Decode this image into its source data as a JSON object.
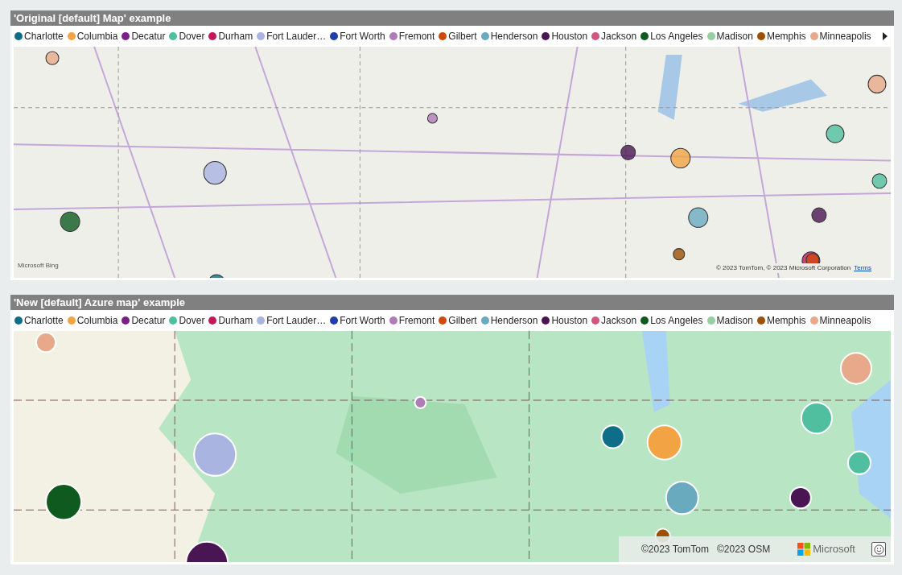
{
  "visuals": [
    {
      "kind": "bing",
      "title": "'Original [default] Map' example",
      "more_arrow": true,
      "legend": [
        {
          "label": "Charlotte",
          "color": "#0e6e89"
        },
        {
          "label": "Columbia",
          "color": "#f2a444"
        },
        {
          "label": "Decatur",
          "color": "#7a1f87"
        },
        {
          "label": "Dover",
          "color": "#4fbf9f"
        },
        {
          "label": "Durham",
          "color": "#c2185b"
        },
        {
          "label": "Fort Lauder…",
          "color": "#a9b4e0"
        },
        {
          "label": "Fort Worth",
          "color": "#1f3ea8"
        },
        {
          "label": "Fremont",
          "color": "#b07cb8"
        },
        {
          "label": "Gilbert",
          "color": "#cc4a0a"
        },
        {
          "label": "Henderson",
          "color": "#6aaabf"
        },
        {
          "label": "Houston",
          "color": "#4a1553"
        },
        {
          "label": "Jackson",
          "color": "#d0577f"
        },
        {
          "label": "Los Angeles",
          "color": "#0f5b1f"
        },
        {
          "label": "Madison",
          "color": "#96d0a0"
        },
        {
          "label": "Memphis",
          "color": "#9c5000"
        },
        {
          "label": "Minneapolis",
          "color": "#e8a98a"
        }
      ],
      "map": {
        "logo": "Microsoft Bing",
        "copyright": "© 2023 TomTom, © 2023 Microsoft Corporation",
        "terms_link": "Terms"
      }
    },
    {
      "kind": "azure",
      "title": "'New [default] Azure map' example",
      "more_arrow": false,
      "legend": [
        {
          "label": "Charlotte",
          "color": "#0e6e89"
        },
        {
          "label": "Columbia",
          "color": "#f2a444"
        },
        {
          "label": "Decatur",
          "color": "#7a1f87"
        },
        {
          "label": "Dover",
          "color": "#4fbf9f"
        },
        {
          "label": "Durham",
          "color": "#c2185b"
        },
        {
          "label": "Fort Lauder…",
          "color": "#a9b4e0"
        },
        {
          "label": "Fort Worth",
          "color": "#1f3ea8"
        },
        {
          "label": "Fremont",
          "color": "#b07cb8"
        },
        {
          "label": "Gilbert",
          "color": "#cc4a0a"
        },
        {
          "label": "Henderson",
          "color": "#6aaabf"
        },
        {
          "label": "Houston",
          "color": "#4a1553"
        },
        {
          "label": "Jackson",
          "color": "#d0577f"
        },
        {
          "label": "Los Angeles",
          "color": "#0f5b1f"
        },
        {
          "label": "Madison",
          "color": "#96d0a0"
        },
        {
          "label": "Memphis",
          "color": "#9c5000"
        },
        {
          "label": "Minneapolis",
          "color": "#e8a98a"
        }
      ],
      "map": {
        "copyrights": [
          "©2023 TomTom",
          "©2023 OSM"
        ],
        "brand": "Microsoft"
      }
    }
  ]
}
